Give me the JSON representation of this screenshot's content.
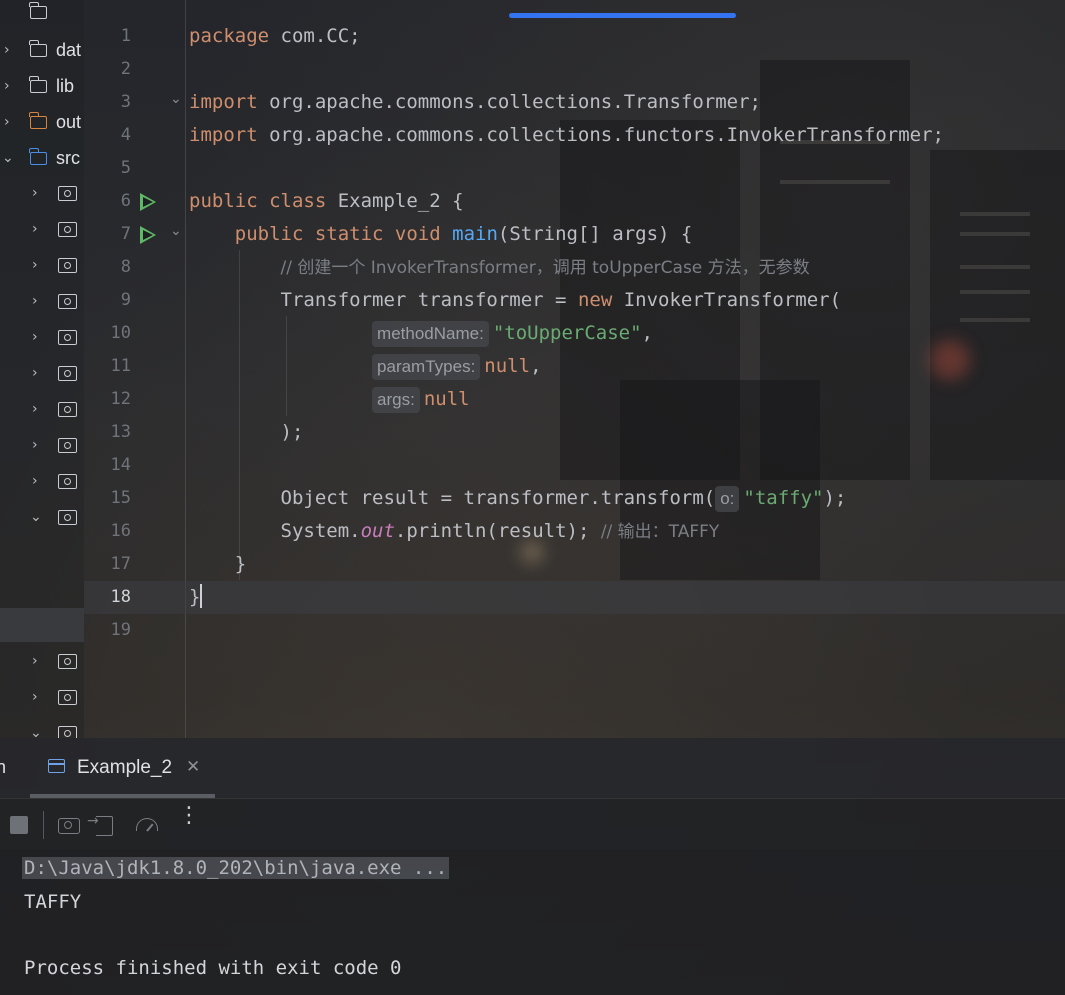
{
  "project_tree": {
    "items": [
      {
        "label": "dat",
        "icon": "folder-icon"
      },
      {
        "label": "lib",
        "icon": "folder-icon"
      },
      {
        "label": "out",
        "icon": "folder-icon"
      },
      {
        "label": "src",
        "icon": "folder-icon"
      }
    ],
    "package_icon": "package-icon"
  },
  "editor": {
    "file_name": "Example_2",
    "lines": [
      {
        "n": "1"
      },
      {
        "n": "2"
      },
      {
        "n": "3"
      },
      {
        "n": "4"
      },
      {
        "n": "5"
      },
      {
        "n": "6"
      },
      {
        "n": "7"
      },
      {
        "n": "8"
      },
      {
        "n": "9"
      },
      {
        "n": "10"
      },
      {
        "n": "11"
      },
      {
        "n": "12"
      },
      {
        "n": "13"
      },
      {
        "n": "14"
      },
      {
        "n": "15"
      },
      {
        "n": "16"
      },
      {
        "n": "17"
      },
      {
        "n": "18"
      },
      {
        "n": "19"
      }
    ],
    "tokens": {
      "l1_kw": "package",
      "l1_rest": " com.CC;",
      "l3_kw": "import",
      "l3_rest": " org.apache.commons.collections.Transformer;",
      "l4_kw": "import",
      "l4_rest": " org.apache.commons.collections.functors.InvokerTransformer;",
      "l6_kw": "public class",
      "l6_rest": " Example_2 {",
      "l7_kw": "public static void",
      "l7_fn": "main",
      "l7_rest": "(String[] args) {",
      "l8_comment_a": "// 创建一个 InvokerTransformer，调用 toUpperCase 方法，无参数",
      "l9_a": "Transformer transformer = ",
      "l9_kw": "new",
      "l9_b": " InvokerTransformer(",
      "l10_hint": "methodName:",
      "l10_str": "\"toUpperCase\"",
      "l10_rest": ",",
      "l11_hint": "paramTypes:",
      "l11_kw": "null",
      "l11_rest": ",",
      "l12_hint": "args:",
      "l12_kw": "null",
      "l13": ");",
      "l15_a": "Object result = transformer.transform(",
      "l15_hint": "o:",
      "l15_str": "\"taffy\"",
      "l15_rest": ");",
      "l16_a": "System.",
      "l16_it": "out",
      "l16_b": ".println(result); ",
      "l16_cm": "// 输出：TAFFY",
      "l17": "}",
      "l18": "}"
    }
  },
  "run_window": {
    "left_label": "n",
    "tab_label": "Example_2",
    "console": {
      "command": "D:\\Java\\jdk1.8.0_202\\bin\\java.exe ...",
      "output": "TAFFY",
      "exit": "Process finished with exit code 0"
    }
  },
  "colors": {
    "keyword": "#cf8e6d",
    "function": "#56a8f5",
    "string": "#6aab73",
    "comment": "#7a7e85",
    "static_field": "#c77dbb",
    "accent": "#3574f0",
    "run_green": "#5fb865"
  }
}
